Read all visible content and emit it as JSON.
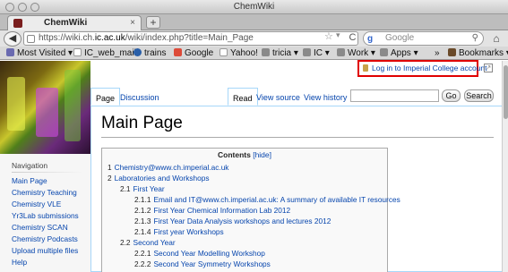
{
  "window": {
    "title": "ChemWiki"
  },
  "tab": {
    "label": "ChemWiki",
    "close": "×",
    "newtab": "+"
  },
  "nav": {
    "back": "◀",
    "url_prefix": "https://wiki.ch.",
    "url_host": "ic.ac.uk",
    "url_rest": "/wiki/index.php?title=Main_Page",
    "star": "☆",
    "dropdown": "▾",
    "reload": "C",
    "search_engine": "g",
    "search_placeholder": "Google",
    "search_btn": "🔍",
    "home": "⌂"
  },
  "bookmarks": [
    {
      "label": "Most Visited ▾",
      "color": "#6a6ab0"
    },
    {
      "label": "IC_web_mail",
      "color": "#ffffff"
    },
    {
      "label": "trains",
      "color": "#2a5fa8"
    },
    {
      "label": "Google",
      "color": "#dd4b39"
    },
    {
      "label": "Yahoo!",
      "color": "#ffffff"
    },
    {
      "label": "tricia ▾",
      "color": "#8a8a8a"
    },
    {
      "label": "IC ▾",
      "color": "#8a8a8a"
    },
    {
      "label": "Work ▾",
      "color": "#8a8a8a"
    },
    {
      "label": "Apps ▾",
      "color": "#8a8a8a"
    },
    {
      "label": "»",
      "color": ""
    },
    {
      "label": "Bookmarks ▾",
      "color": "#6a4a2a"
    }
  ],
  "personal": {
    "login": "Log in to Imperial College account"
  },
  "page_tabs": {
    "page": "Page",
    "discussion": "Discussion",
    "read": "Read",
    "view_source": "View source",
    "view_history": "View history"
  },
  "search": {
    "go": "Go",
    "search": "Search"
  },
  "heading": "Main Page",
  "toc": {
    "title": "Contents",
    "hide": "[hide]",
    "items": [
      {
        "num": "1",
        "text": "Chemistry@www.ch.imperial.ac.uk"
      },
      {
        "num": "2",
        "text": "Laboratories and Workshops"
      },
      {
        "num": "2.1",
        "text": "First Year"
      },
      {
        "num": "2.1.1",
        "text": "Email and IT@www.ch.imperial.ac.uk: A summary of available IT resources"
      },
      {
        "num": "2.1.2",
        "text": "First Year Chemical Information Lab 2012"
      },
      {
        "num": "2.1.3",
        "text": "First Year Data Analysis workshops and lectures 2012"
      },
      {
        "num": "2.1.4",
        "text": "First year Workshops"
      },
      {
        "num": "2.2",
        "text": "Second Year"
      },
      {
        "num": "2.2.1",
        "text": "Second Year Modelling Workshop"
      },
      {
        "num": "2.2.2",
        "text": "Second Year Symmetry Workshops"
      }
    ]
  },
  "sidebar": {
    "heading": "Navigation",
    "items": [
      "Main Page",
      "Chemistry Teaching",
      "Chemistry VLE",
      "Yr3Lab submissions",
      "Chemistry SCAN",
      "Chemistry Podcasts",
      "Upload multiple files",
      "Help"
    ]
  }
}
